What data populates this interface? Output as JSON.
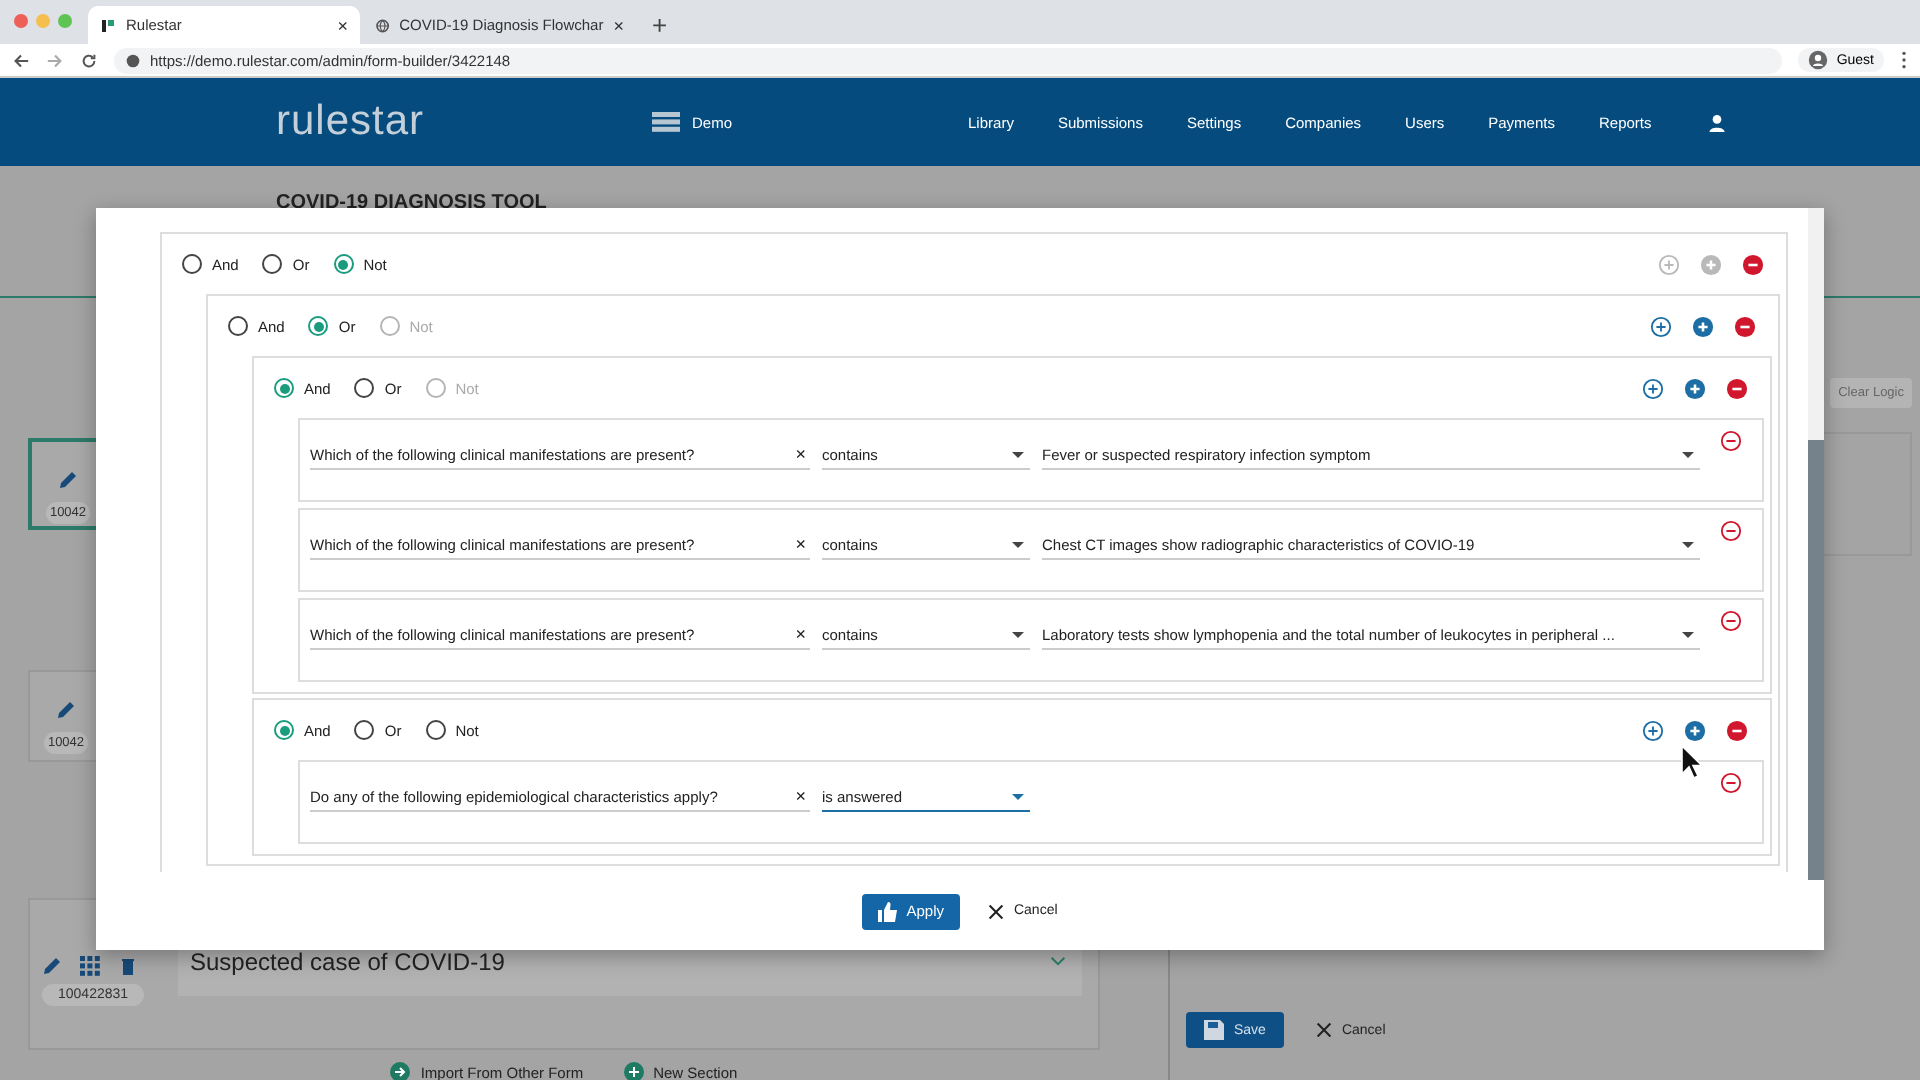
{
  "browser": {
    "tabs": [
      {
        "title": "Rulestar",
        "selected": true,
        "close": "×"
      },
      {
        "title": "COVID-19 Diagnosis Flowchar",
        "selected": false,
        "close": "×"
      }
    ],
    "new_tab": "+",
    "url": "https://demo.rulestar.com/admin/form-builder/3422148",
    "profile": "Guest"
  },
  "nav": {
    "logo": "rulestar",
    "workspace": "Demo",
    "links": [
      "Library",
      "Submissions",
      "Settings",
      "Companies",
      "Users",
      "Payments",
      "Reports"
    ]
  },
  "page": {
    "title": "COVID-19 DIAGNOSIS TOOL",
    "clear_logic": "Clear Logic",
    "cards": [
      {
        "id": "10042",
        "selected": true
      },
      {
        "id": "10042",
        "selected": false
      },
      {
        "id": "100422831",
        "title": "Suspected case of COVID-19",
        "selected": false
      }
    ],
    "import": "Import From Other Form",
    "new_section": "New Section",
    "save": "Save",
    "cancel": "Cancel"
  },
  "modal": {
    "group": {
      "kind": "group",
      "actions_disabled": true,
      "operators": [
        {
          "label": "And",
          "selected": false,
          "disabled": false
        },
        {
          "label": "Or",
          "selected": false,
          "disabled": false
        },
        {
          "label": "Not",
          "selected": true,
          "disabled": false
        }
      ],
      "children": [
        {
          "kind": "group",
          "actions_disabled": false,
          "operators": [
            {
              "label": "And",
              "selected": false,
              "disabled": false
            },
            {
              "label": "Or",
              "selected": true,
              "disabled": false
            },
            {
              "label": "Not",
              "selected": false,
              "disabled": true
            }
          ],
          "children": [
            {
              "kind": "group",
              "actions_disabled": false,
              "operators": [
                {
                  "label": "And",
                  "selected": true,
                  "disabled": false
                },
                {
                  "label": "Or",
                  "selected": false,
                  "disabled": false
                },
                {
                  "label": "Not",
                  "selected": false,
                  "disabled": true
                }
              ],
              "children": [
                {
                  "kind": "condition",
                  "question": "Which of the following clinical manifestations are present?",
                  "clear": "×",
                  "operator": "contains",
                  "active": false,
                  "value": "Fever or suspected respiratory infection symptom"
                },
                {
                  "kind": "condition",
                  "question": "Which of the following clinical manifestations are present?",
                  "clear": "×",
                  "operator": "contains",
                  "active": false,
                  "value": "Chest CT images show radiographic characteristics of COVIO-19"
                },
                {
                  "kind": "condition",
                  "question": "Which of the following clinical manifestations are present?",
                  "clear": "×",
                  "operator": "contains",
                  "active": false,
                  "value": "Laboratory tests show lymphopenia and the total number of leukocytes in peripheral ..."
                }
              ]
            },
            {
              "kind": "group",
              "actions_disabled": false,
              "operators": [
                {
                  "label": "And",
                  "selected": true,
                  "disabled": false
                },
                {
                  "label": "Or",
                  "selected": false,
                  "disabled": false
                },
                {
                  "label": "Not",
                  "selected": false,
                  "disabled": false
                }
              ],
              "children": [
                {
                  "kind": "condition",
                  "question": "Do any of the following epidemiological characteristics apply?",
                  "clear": "×",
                  "operator": "is answered",
                  "active": true
                }
              ]
            }
          ]
        }
      ]
    },
    "apply": "Apply",
    "cancel": "Cancel"
  }
}
